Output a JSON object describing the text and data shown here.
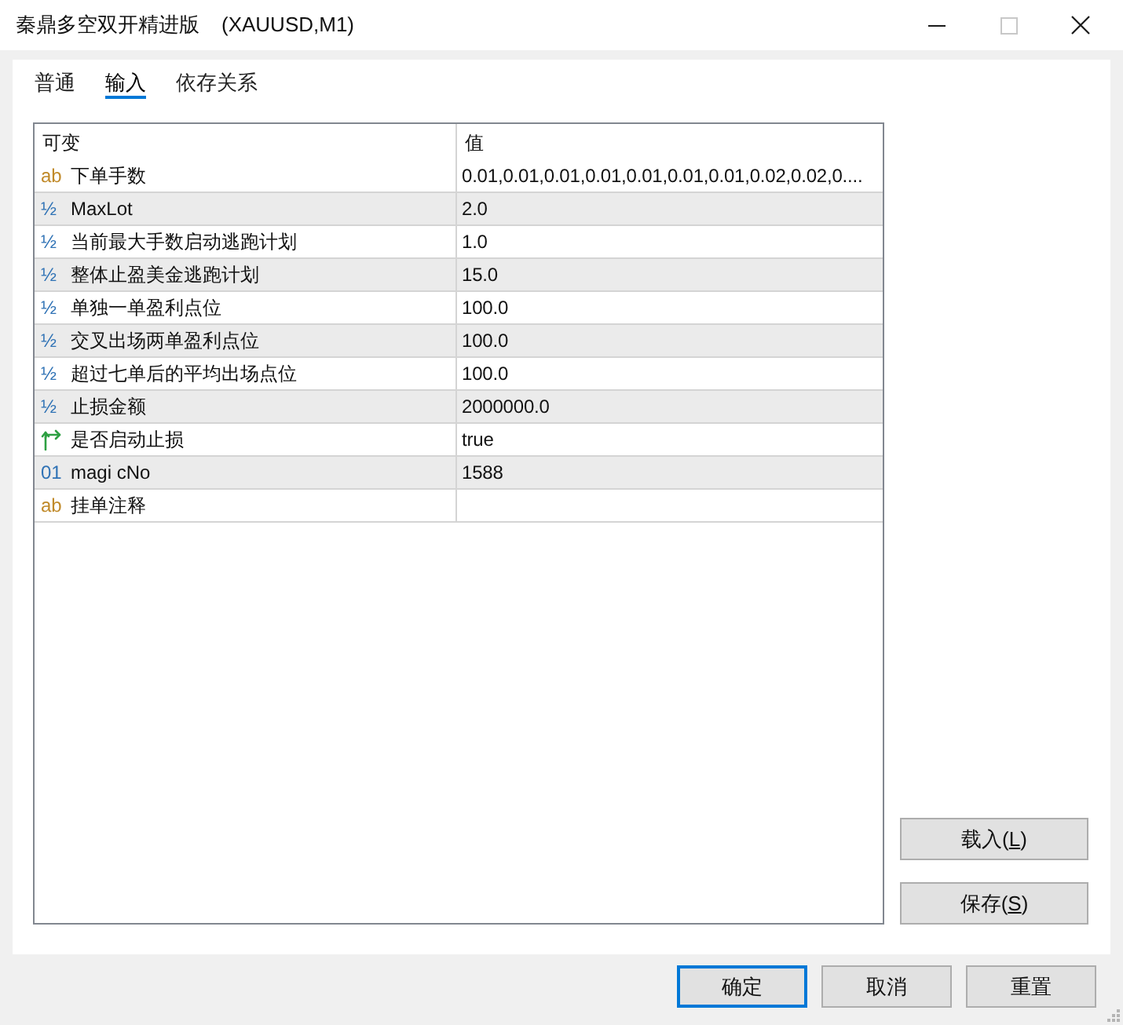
{
  "window": {
    "title": "秦鼎多空双开精进版",
    "symbol": "(XAUUSD,M1)",
    "controls": [
      {
        "kind": "minimize",
        "disabled": false
      },
      {
        "kind": "maximize",
        "disabled": true
      },
      {
        "kind": "close",
        "disabled": false
      }
    ]
  },
  "tabs": [
    {
      "label": "普通",
      "selected": false
    },
    {
      "label": "输入",
      "selected": true
    },
    {
      "label": "依存关系",
      "selected": false
    }
  ],
  "table": {
    "columns": [
      "可变",
      "值"
    ],
    "rows": [
      {
        "kind": "string",
        "type_icon": "ab",
        "name": "下单手数",
        "value": "0.01,0.01,0.01,0.01,0.01,0.01,0.01,0.02,0.02,0...."
      },
      {
        "kind": "double",
        "type_icon": "½",
        "name": "MaxLot",
        "value": "2.0"
      },
      {
        "kind": "double",
        "type_icon": "½",
        "name": "当前最大手数启动逃跑计划",
        "value": "1.0"
      },
      {
        "kind": "double",
        "type_icon": "½",
        "name": "整体止盈美金逃跑计划",
        "value": "15.0"
      },
      {
        "kind": "double",
        "type_icon": "½",
        "name": "单独一单盈利点位",
        "value": "100.0"
      },
      {
        "kind": "double",
        "type_icon": "½",
        "name": "交叉出场两单盈利点位",
        "value": "100.0"
      },
      {
        "kind": "double",
        "type_icon": "½",
        "name": "超过七单后的平均出场点位",
        "value": "100.0"
      },
      {
        "kind": "double",
        "type_icon": "½",
        "name": "止损金额",
        "value": "2000000.0"
      },
      {
        "kind": "bool",
        "name": "是否启动止损",
        "value": "true"
      },
      {
        "kind": "int",
        "type_icon": "01",
        "name": "magi cNo",
        "value": "1588"
      },
      {
        "kind": "string",
        "type_icon": "ab",
        "name": "挂单注释"
      }
    ]
  },
  "side_buttons": [
    {
      "text": "载入(",
      "hotkey": "L",
      "text_end": ")"
    },
    {
      "text": "保存(",
      "hotkey": "S",
      "text_end": ")"
    }
  ],
  "buttons": [
    {
      "label": "确定",
      "default": true
    },
    {
      "label": "取消",
      "default": false
    },
    {
      "label": "重置",
      "default": false
    }
  ]
}
